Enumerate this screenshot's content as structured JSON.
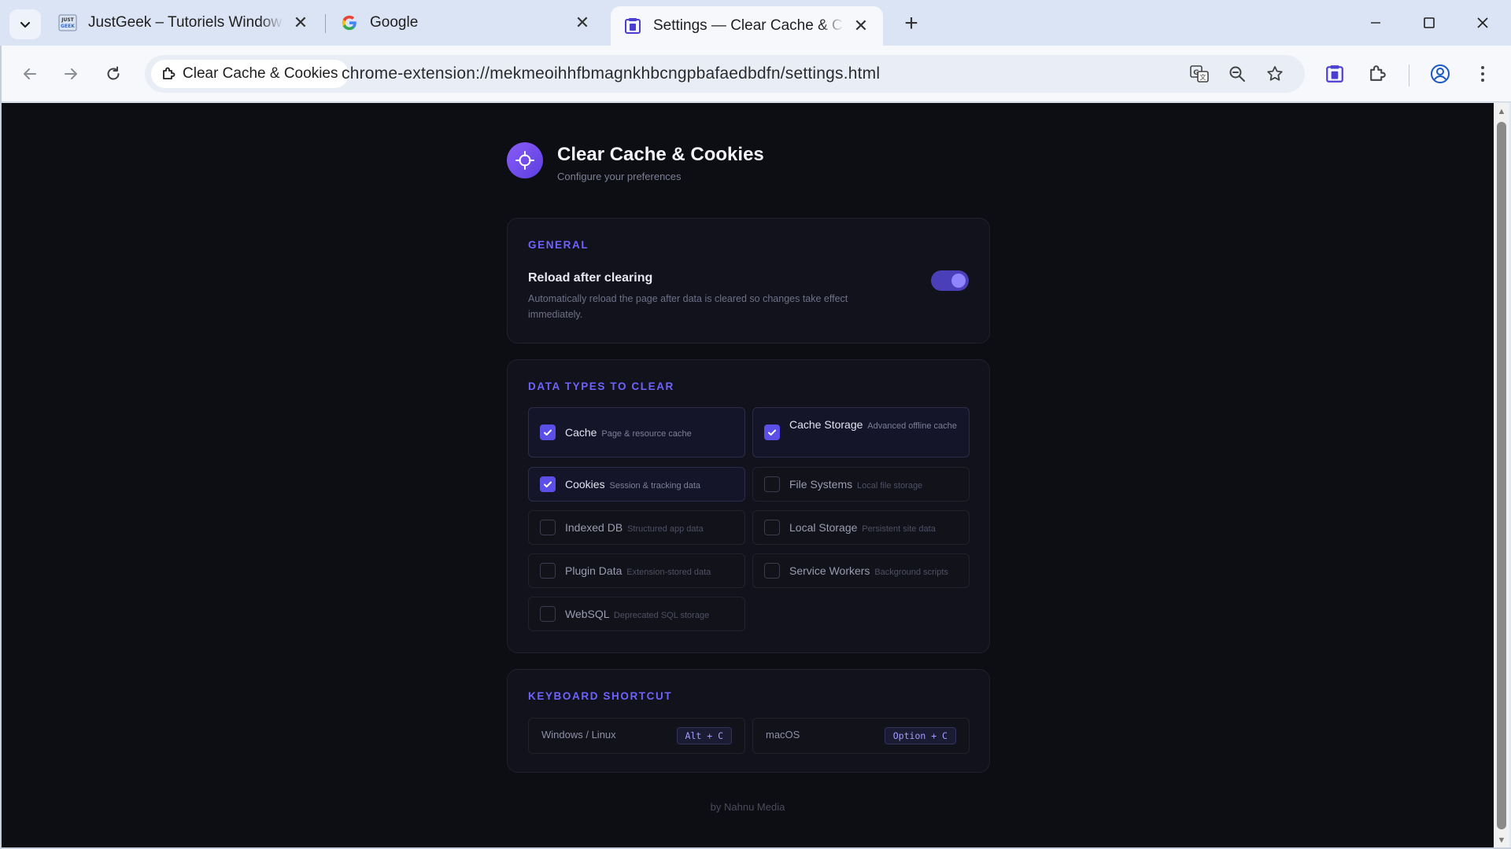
{
  "browser": {
    "tabs": [
      {
        "title": "JustGeek – Tutoriels Windows, Internet",
        "favicon": "justgeek-favicon",
        "active": false
      },
      {
        "title": "Google",
        "favicon": "google-favicon",
        "active": false
      },
      {
        "title": "Settings — Clear Cache & Cookies",
        "favicon": "extension-settings-favicon",
        "active": true
      }
    ],
    "site_chip": "Clear Cache & Cookies",
    "url": "chrome-extension://mekmeoihhfbmagnkhbcngpbafaedbdfn/settings.html"
  },
  "page": {
    "title": "Clear Cache & Cookies",
    "subtitle": "Configure your preferences",
    "general": {
      "label": "GENERAL",
      "reload_title": "Reload after clearing",
      "reload_desc": "Automatically reload the page after data is cleared so changes take effect immediately.",
      "reload_enabled": true
    },
    "data_types": {
      "label": "DATA TYPES TO CLEAR",
      "items": [
        {
          "name": "Cache",
          "hint": "Page & resource cache",
          "checked": true
        },
        {
          "name": "Cache Storage",
          "hint": "Advanced offline cache",
          "checked": true
        },
        {
          "name": "Cookies",
          "hint": "Session & tracking data",
          "checked": true
        },
        {
          "name": "File Systems",
          "hint": "Local file storage",
          "checked": false
        },
        {
          "name": "Indexed DB",
          "hint": "Structured app data",
          "checked": false
        },
        {
          "name": "Local Storage",
          "hint": "Persistent site data",
          "checked": false
        },
        {
          "name": "Plugin Data",
          "hint": "Extension-stored data",
          "checked": false
        },
        {
          "name": "Service Workers",
          "hint": "Background scripts",
          "checked": false
        },
        {
          "name": "WebSQL",
          "hint": "Deprecated SQL storage",
          "checked": false
        }
      ]
    },
    "shortcut": {
      "label": "KEYBOARD SHORTCUT",
      "windows_label": "Windows / Linux",
      "windows_keys": "Alt + C",
      "mac_label": "macOS",
      "mac_keys": "Option + C"
    },
    "footer": "by Nahnu Media"
  },
  "colors": {
    "accent": "#5b4fe8",
    "page_bg": "#0d0d14",
    "card_bg": "#12121c"
  }
}
